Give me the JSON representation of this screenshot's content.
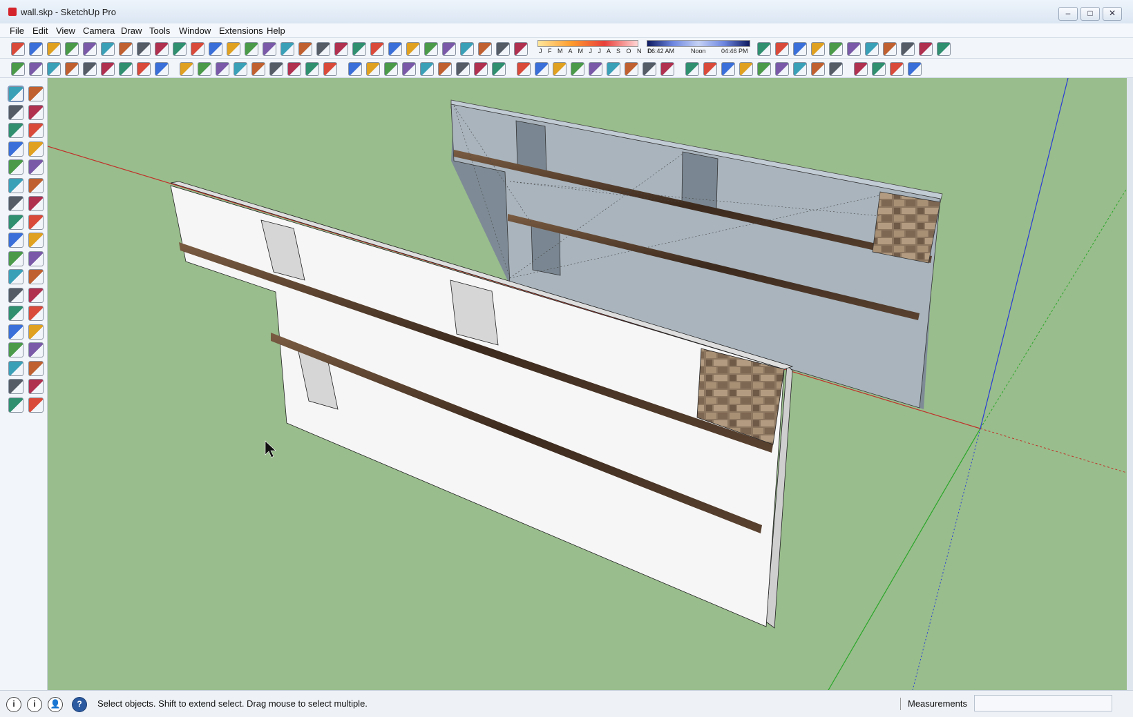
{
  "window": {
    "title": "wall.skp - SketchUp Pro",
    "controls": {
      "minimize": "–",
      "maximize": "□",
      "close": "✕"
    }
  },
  "menubar": {
    "items": [
      "File",
      "Edit",
      "View",
      "Camera",
      "Draw",
      "Tools",
      "Window",
      "Extensions",
      "Help"
    ]
  },
  "shadows": {
    "months": "J F M A M J J A S O N D",
    "time_start": "06:42 AM",
    "time_noon": "Noon",
    "time_end": "04:46 PM"
  },
  "status": {
    "message": "Select objects. Shift to extend select. Drag mouse to select multiple.",
    "measurements_label": "Measurements",
    "measurements_value": "",
    "icons": {
      "geo": "i",
      "credits": "i",
      "sign_in": "👤",
      "help": "?"
    }
  },
  "colors": {
    "viewport_bg": "#99bd8c",
    "wall_front": "#f6f6f6",
    "wall_back_face": "#a9b4bd",
    "trim": "#5a4230",
    "axis_red": "#c0302a",
    "axis_green": "#28a628",
    "axis_blue": "#2a3cd6",
    "stone": "#8c7660"
  },
  "icons": {
    "toolbar_row1": [
      "new-icon",
      "open-icon",
      "save-icon",
      "cut-icon",
      "copy-icon",
      "paste-icon",
      "erase-icon",
      "undo-icon",
      "redo-icon",
      "print-icon",
      "model-info-icon",
      "iso-view-icon",
      "top-view-icon",
      "front-view-icon",
      "right-view-icon",
      "back-view-icon",
      "left-view-icon",
      "xray-icon",
      "backedges-icon",
      "wireframe-icon",
      "hiddenline-icon",
      "shaded-icon",
      "shaded-textures-icon",
      "monochrome-icon",
      "shadows-toggle-icon",
      "fog-icon",
      "warehouse-icon",
      "components-icon",
      "extension-warehouse-icon",
      "section-plane-icon",
      "add-location-icon",
      "terrain-icon",
      "layout-icon",
      "style-builder-icon",
      "dynamic-components-icon",
      "film-icon",
      "geo-icon",
      "photo-match-icon",
      "triangle-icon",
      "color-palette-icon"
    ],
    "toolbar_row2": [
      "arc-icon",
      "freehand-icon",
      "bezier-icon",
      "line-icon",
      "curve-icon",
      "rectangle-icon",
      "circle-icon",
      "polygon-icon",
      "pie-icon",
      "spline-icon",
      "offset-icon",
      "chord-icon",
      "weld-icon",
      "wrench-icon",
      "ellipse-icon",
      "rubber-icon",
      "intersect-icon",
      "split-icon",
      "trim-icon",
      "extend-icon",
      "fillet-icon",
      "chamfer-icon",
      "stretch-icon",
      "clip-icon",
      "explode-icon",
      "merge-icon",
      "help-icon",
      "sandbox-smoove-icon",
      "sandbox-stamp-icon",
      "sandbox-drape-icon",
      "sandbox-details-icon",
      "sandbox-flip-icon",
      "sandbox-add-icon",
      "sandbox-from-contours-icon",
      "sandbox-from-scratch-icon",
      "subdivide-icon",
      "crease-icon",
      "push-icon",
      "push-pull-all-icon",
      "pull-icon",
      "move-axes-icon",
      "rotate-axes-icon",
      "flip-icon",
      "scale-icon",
      "solid-tools-icon",
      "inspector-icon",
      "outer-shell-icon",
      "union-icon",
      "target-icon"
    ],
    "left_tools": [
      "select-icon",
      "component-icon",
      "paint-bucket-icon",
      "eraser-icon",
      "pencil-icon",
      "freehand-curve-icon",
      "rectangle-tool-icon",
      "rotated-rectangle-icon",
      "circle-tool-icon",
      "polygon-tool-icon",
      "arc-tool-icon",
      "two-point-arc-icon",
      "three-point-arc-icon",
      "pie-tool-icon",
      "move-tool-icon",
      "push-pull-tool-icon",
      "rotate-tool-icon",
      "follow-me-icon",
      "scale-tool-icon",
      "offset-tool-icon",
      "tape-measure-icon",
      "dimension-icon",
      "protractor-icon",
      "text-tool-icon",
      "axes-tool-icon",
      "3d-text-icon",
      "orbit-icon",
      "pan-icon",
      "zoom-icon",
      "zoom-window-icon",
      "zoom-extents-icon",
      "previous-view-icon",
      "walk-icon",
      "look-around-icon",
      "position-camera-icon",
      "section-plane-tool-icon"
    ]
  }
}
